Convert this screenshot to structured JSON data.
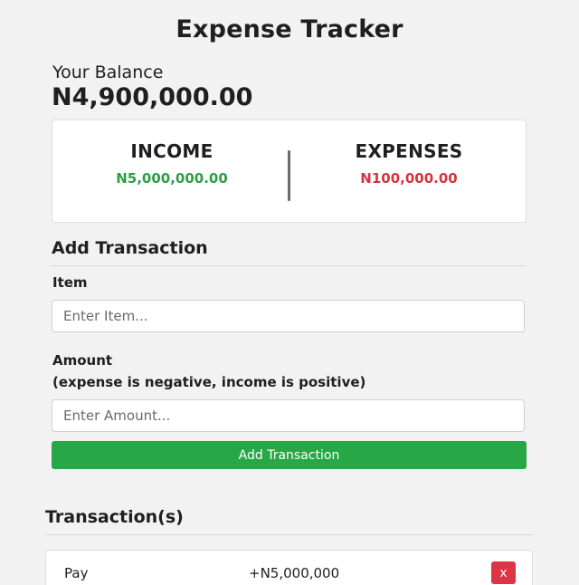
{
  "app": {
    "title": "Expense Tracker"
  },
  "balance": {
    "label": "Your Balance",
    "value": "N4,900,000.00"
  },
  "summary": {
    "income_label": "INCOME",
    "income_value": "N5,000,000.00",
    "expenses_label": "EXPENSES",
    "expenses_value": "N100,000.00",
    "income_color": "#2e9e44",
    "expenses_color": "#d6343f"
  },
  "form": {
    "heading": "Add Transaction",
    "item_label": "Item",
    "item_placeholder": "Enter Item...",
    "item_value": "",
    "amount_label": "Amount",
    "amount_hint": "(expense is negative, income is positive)",
    "amount_placeholder": "Enter Amount...",
    "amount_value": "",
    "submit_label": "Add Transaction",
    "submit_color": "#27a745"
  },
  "transactions": {
    "heading": "Transaction(s)",
    "items": [
      {
        "name": "Pay",
        "amount": "+N5,000,000",
        "delete_label": "x"
      }
    ],
    "delete_color": "#dc3545"
  }
}
